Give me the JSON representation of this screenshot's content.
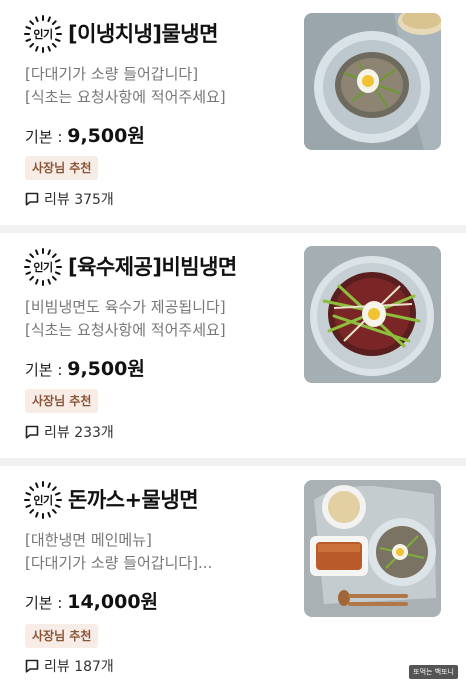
{
  "menu": {
    "items": [
      {
        "badge": "인기",
        "name": "[이냉치냉]물냉면",
        "desc": [
          "[다대기가 소량 들어갑니다]",
          "[식초는 요청사항에 적어주세요]"
        ],
        "price_label": "기본 :",
        "price": "9,500원",
        "owner_badge": "사장님 추천",
        "review_label": "리뷰 375개",
        "image_icon": "mul-naengmyeon-photo"
      },
      {
        "badge": "인기",
        "name": "[육수제공]비빔냉면",
        "desc": [
          "[비빔냉면도 육수가 제공됩니다]",
          "[식초는 요청사항에 적어주세요]"
        ],
        "price_label": "기본 :",
        "price": "9,500원",
        "owner_badge": "사장님 추천",
        "review_label": "리뷰 233개",
        "image_icon": "bibim-naengmyeon-photo"
      },
      {
        "badge": "인기",
        "name": "돈까스+물냉면",
        "desc": [
          "[대한냉면 메인메뉴]",
          "[다대기가 소량 들어갑니다]..."
        ],
        "price_label": "기본 :",
        "price": "14,000원",
        "owner_badge": "사장님 추천",
        "review_label": "리뷰 187개",
        "image_icon": "donkatsu-set-photo"
      }
    ]
  },
  "watermark": "또먹는 백또니",
  "colors": {
    "owner_badge_bg": "#f7ede6",
    "owner_badge_text": "#8a5436",
    "divider": "#f1f1f1"
  }
}
